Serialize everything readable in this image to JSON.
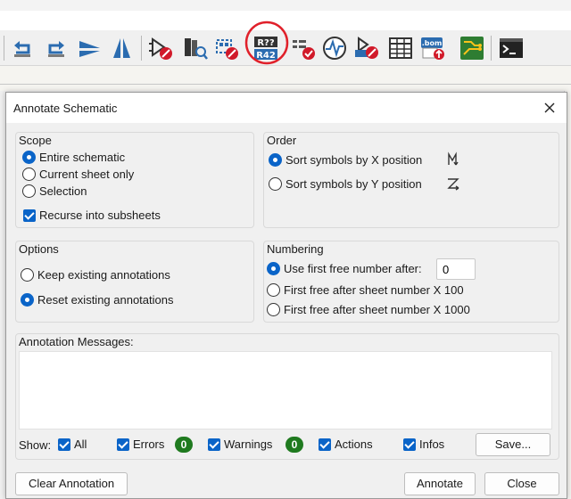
{
  "toolbar": {
    "icons": [
      "undo-icon",
      "redo-icon",
      "mirror-horizontal-icon",
      "mirror-vertical-icon",
      "erc-check-icon",
      "symbol-library-icon",
      "symbol-editor-icon",
      "annotate-icon",
      "fields-table-icon",
      "simulator-icon",
      "footprint-assign-icon",
      "symbol-fields-table-icon",
      "bom-generate-icon",
      "pcb-editor-icon",
      "scripting-console-icon"
    ],
    "annotate_icon_text_top": "R??",
    "annotate_icon_text_bottom": "R42",
    "bom_text": ".bom",
    "highlight_color": "#e0202a"
  },
  "dialog": {
    "title": "Annotate Schematic",
    "scope": {
      "label": "Scope",
      "options": [
        "Entire schematic",
        "Current sheet only",
        "Selection"
      ],
      "selected": "Entire schematic",
      "recurse_label": "Recurse into subsheets",
      "recurse_checked": true
    },
    "order": {
      "label": "Order",
      "options": [
        "Sort symbols by X position",
        "Sort symbols by Y position"
      ],
      "selected": "Sort symbols by X position"
    },
    "options": {
      "label": "Options",
      "choices": [
        "Keep existing annotations",
        "Reset existing annotations"
      ],
      "selected": "Reset existing annotations"
    },
    "numbering": {
      "label": "Numbering",
      "choices": [
        "Use first free number after:",
        "First free after sheet number X 100",
        "First free after sheet number X 1000"
      ],
      "selected": "Use first free number after:",
      "start_value": "0"
    },
    "messages": {
      "label": "Annotation Messages:",
      "show_label": "Show:",
      "filters": {
        "all": "All",
        "errors": "Errors",
        "errors_count": "0",
        "warnings": "Warnings",
        "warnings_count": "0",
        "actions": "Actions",
        "infos": "Infos"
      },
      "save_button": "Save..."
    },
    "buttons": {
      "clear": "Clear Annotation",
      "annotate": "Annotate",
      "close": "Close"
    }
  },
  "colors": {
    "accent": "#0a64c8",
    "badge_green": "#1f7a1f"
  }
}
